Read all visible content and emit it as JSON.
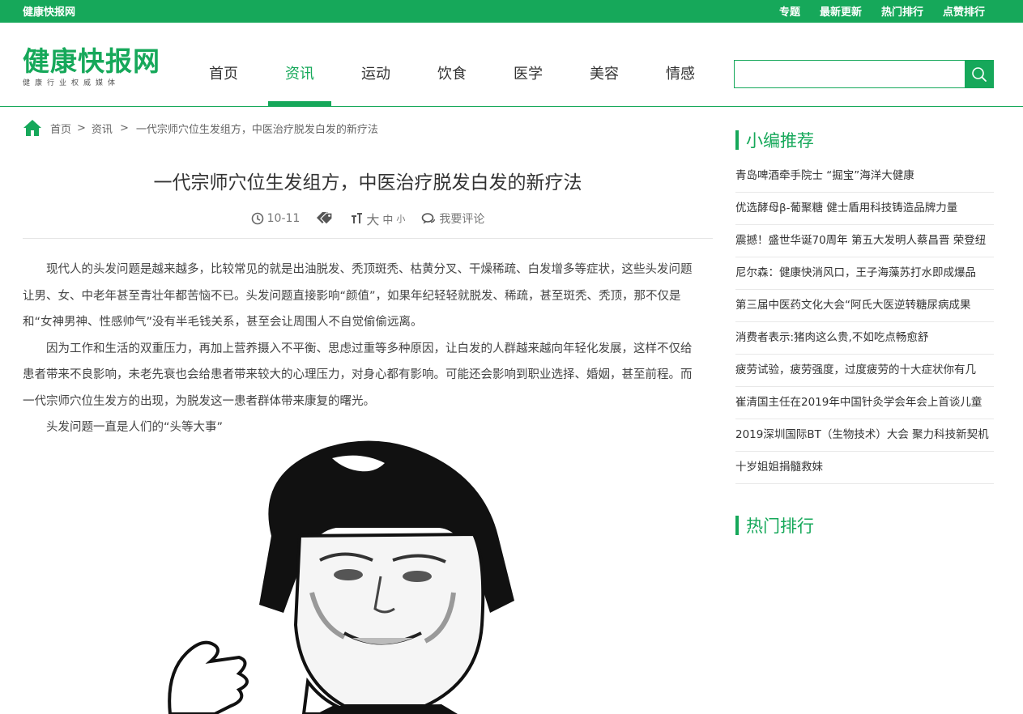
{
  "topbar": {
    "site_name": "健康快报网",
    "links": [
      "专题",
      "最新更新",
      "热门排行",
      "点赞排行"
    ]
  },
  "header": {
    "logo_text": "健康快报网",
    "logo_sub": "健康行业权威媒体",
    "nav": [
      "首页",
      "资讯",
      "运动",
      "饮食",
      "医学",
      "美容",
      "情感"
    ],
    "active_nav": "资讯",
    "search_placeholder": ""
  },
  "breadcrumb": {
    "home": "首页",
    "sep1": ">",
    "section": "资讯",
    "sep2": ">",
    "current": "一代宗师穴位生发组方，中医治疗脱发白发的新疗法"
  },
  "article": {
    "title": "一代宗师穴位生发组方，中医治疗脱发白发的新疗法",
    "date": "10-11",
    "font_label": "大",
    "font_mid": "中",
    "font_small": "小",
    "comment": "我要评论",
    "paragraphs": [
      "现代人的头发问题是越来越多，比较常见的就是出油脱发、秃顶斑秃、枯黄分叉、干燥稀疏、白发增多等症状，这些头发问题让男、女、中老年甚至青壮年都苦恼不已。头发问题直接影响“颜值”，如果年纪轻轻就脱发、稀疏，甚至斑秃、秃顶，那不仅是和“女神男神、性感帅气”没有半毛钱关系，甚至会让周围人不自觉偷偷远离。",
      "因为工作和生活的双重压力，再加上营养摄入不平衡、思虑过重等多种原因，让白发的人群越来越向年轻化发展，这样不仅给患者带来不良影响，未老先衰也会给患者带来较大的心理压力，对身心都有影响。可能还会影响到职业选择、婚姻，甚至前程。而一代宗师穴位生发方的出现，为脱发这一患者群体带来康复的曙光。",
      "头发问题一直是人们的“头等大事”"
    ]
  },
  "sidebar": {
    "recommend_title": "小编推荐",
    "recommend": [
      "青岛啤酒牵手院士 “掘宝”海洋大健康",
      "优选酵母β-葡聚糖 健士盾用科技铸造品牌力量",
      "震撼！盛世华诞70周年 第五大发明人蔡昌晋 荣登纽",
      "尼尔森：健康快消风口，王子海藻苏打水即成爆品",
      "第三届中医药文化大会“阿氏大医逆转糖尿病成果",
      "消费者表示:猪肉这么贵,不如吃点畅愈舒",
      "疲劳试验，疲劳强度，过度疲劳的十大症状你有几",
      "崔清国主任在2019年中国针灸学会年会上首谈儿童",
      "2019深圳国际BT（生物技术）大会 聚力科技新契机",
      "十岁姐姐捐髓救妹"
    ],
    "hot_title": "热门排行"
  },
  "colors": {
    "brand": "#16a85a",
    "text": "#333333",
    "muted": "#777777"
  },
  "icons": [
    "home-icon",
    "search-icon",
    "clock-icon",
    "tag-icon",
    "font-size-icon",
    "comment-icon"
  ]
}
